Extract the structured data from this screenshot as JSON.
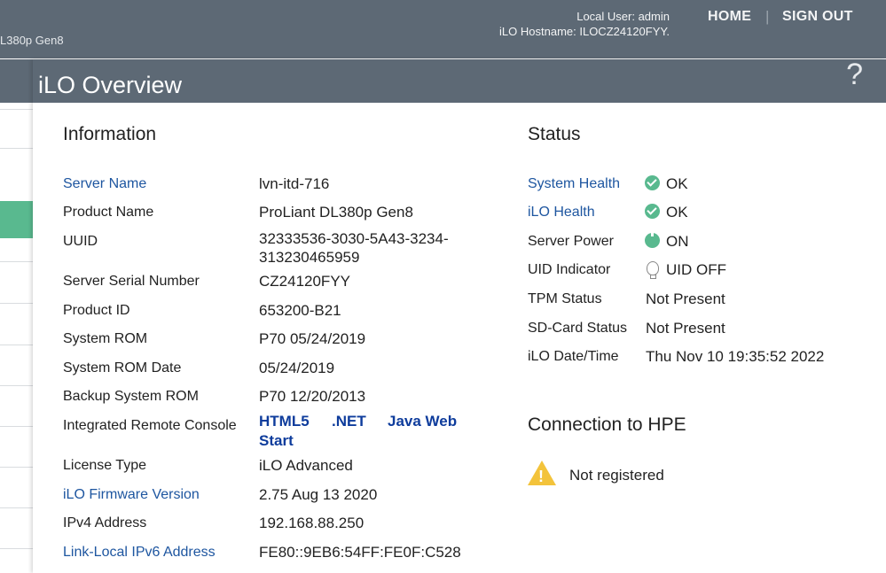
{
  "header": {
    "product_model": "L380p Gen8",
    "local_user": "Local User: admin",
    "hostname": "iLO Hostname: ILOCZ24120FYY.",
    "home_label": "HOME",
    "separator": "|",
    "signout_label": "SIGN OUT"
  },
  "overlay": {
    "title": "iLO Overview",
    "help_glyph": "?"
  },
  "information": {
    "title": "Information",
    "rows": [
      {
        "label": "Server Name",
        "value": "lvn-itd-716",
        "link": true
      },
      {
        "label": "Product Name",
        "value": "ProLiant DL380p Gen8",
        "link": false
      },
      {
        "label": "UUID",
        "value": "32333536-3030-5A43-3234-",
        "value2": "313230465959",
        "link": false
      },
      {
        "label": "Server Serial Number",
        "value": "CZ24120FYY",
        "link": false
      },
      {
        "label": "Product ID",
        "value": "653200-B21",
        "link": false
      },
      {
        "label": "System ROM",
        "value": "P70 05/24/2019",
        "link": false
      },
      {
        "label": "System ROM Date",
        "value": "05/24/2019",
        "link": false
      },
      {
        "label": "Backup System ROM",
        "value": "P70 12/20/2013",
        "link": false
      },
      {
        "label": "Integrated Remote Console",
        "link": false
      },
      {
        "label": "License Type",
        "value": "iLO Advanced",
        "link": false
      },
      {
        "label": "iLO Firmware Version",
        "value": "2.75 Aug 13 2020",
        "link": true
      },
      {
        "label": "IPv4 Address",
        "value": "192.168.88.250",
        "link": false
      },
      {
        "label": "Link-Local IPv6 Address",
        "value": "FE80::9EB6:54FF:FE0F:C528",
        "link": true
      }
    ],
    "remote_console": {
      "html5": "HTML5",
      "net": ".NET",
      "java_line1": "Java Web",
      "java_line2": "Start"
    }
  },
  "status": {
    "title": "Status",
    "rows": [
      {
        "label": "System Health",
        "value": "OK",
        "icon": "ok-check-icon",
        "link": true
      },
      {
        "label": "iLO Health",
        "value": "OK",
        "icon": "ok-check-icon",
        "link": true
      },
      {
        "label": "Server Power",
        "value": "ON",
        "icon": "power-icon",
        "link": false
      },
      {
        "label": "UID Indicator",
        "value": "UID OFF",
        "icon": "bulb-icon",
        "link": false
      },
      {
        "label": "TPM Status",
        "value": "Not Present",
        "link": false
      },
      {
        "label": "SD-Card Status",
        "value": "Not Present",
        "link": false
      },
      {
        "label": "iLO Date/Time",
        "value": "Thu Nov 10 19:35:52 2022",
        "link": false
      }
    ]
  },
  "connection": {
    "title": "Connection to HPE",
    "status": "Not registered",
    "icon": "warning-icon"
  },
  "colors": {
    "header_bg": "#5d6975",
    "link": "#1e56a0",
    "ok_green": "#59b98f",
    "warning_yellow": "#f3c33b"
  }
}
